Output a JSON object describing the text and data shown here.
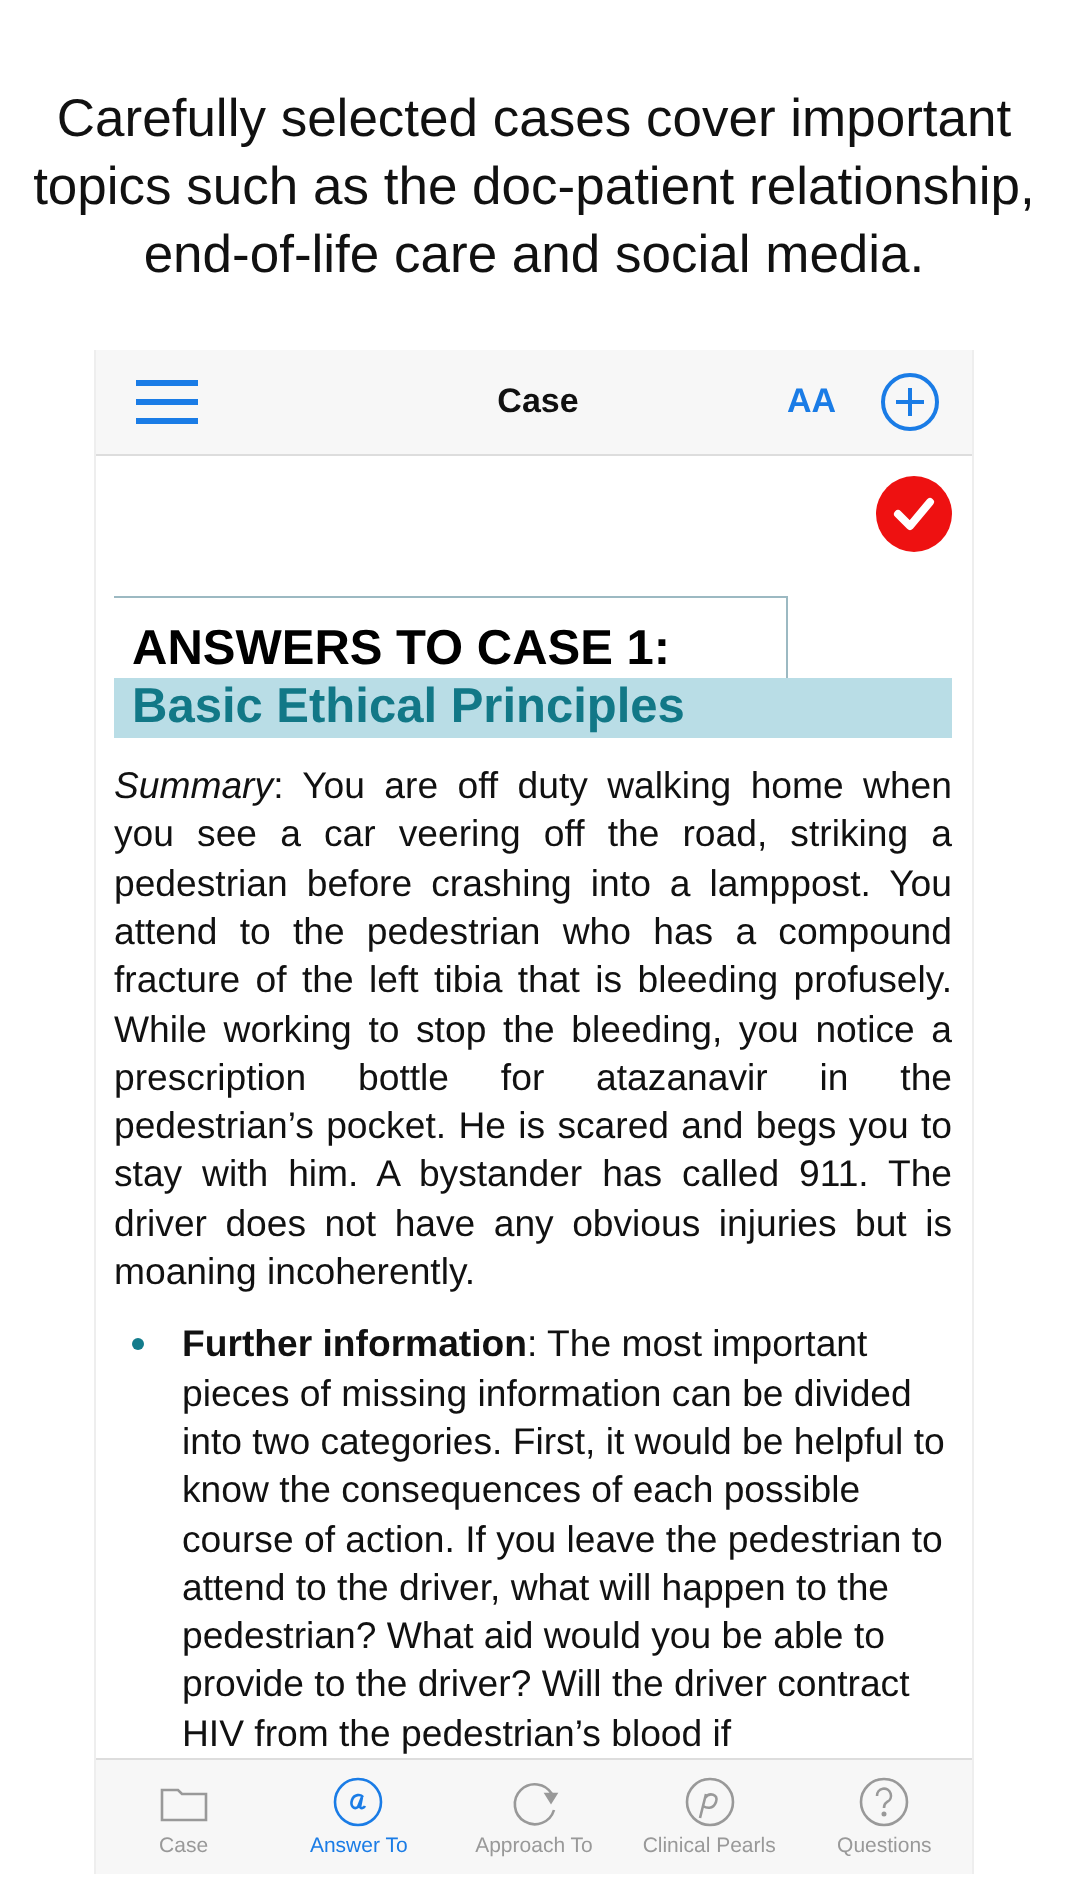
{
  "caption": "Carefully selected cases cover important topics such as the doc-patient relationship, end-of-life care and social media.",
  "nav": {
    "title": "Case",
    "font_button": "AA"
  },
  "case_completed": true,
  "heading": {
    "title": "ANSWERS TO CASE 1:",
    "subtitle": "Basic Ethical Principles"
  },
  "summary": "*Summary*: You are off duty walking home when you see a car veering off the road, striking a pedestrian before crashing into a lamppost. You attend to the pedestrian who has a compound fracture of the left tibia that is bleeding profusely. While working to stop the bleeding, you notice a prescription bottle for atazanavir in the pedestrian’s pocket. He is scared and begs you to stay with him. A bystander has called 911. The driver does not have any obvious injuries but is moaning incoherently.",
  "bullets": [
    "**Further information**: The most important pieces of missing information can be divided into two categories. First, it would be helpful to know the consequences of each possible course of action. If you leave the pedestrian to attend to the driver, what will happen to the pedestrian? What aid would you be able to provide to the driver? Will the driver contract HIV from the pedestrian’s blood if"
  ],
  "tabs": [
    {
      "kind": "folder",
      "label": "Case",
      "selected": false
    },
    {
      "kind": "at",
      "label": "Answer To",
      "selected": true
    },
    {
      "kind": "refresh",
      "label": "Approach To",
      "selected": false
    },
    {
      "kind": "pearl",
      "label": "Clinical Pearls",
      "selected": false
    },
    {
      "kind": "question",
      "label": "Questions",
      "selected": false
    }
  ]
}
